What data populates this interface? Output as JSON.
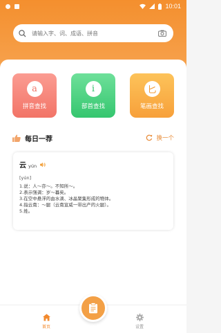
{
  "status_bar": {
    "time": "10:01"
  },
  "search": {
    "placeholder": "请输入字、词、成语、拼音"
  },
  "cards": [
    {
      "glyph": "a",
      "label": "拼音查找"
    },
    {
      "glyph": "i",
      "label": "部首查找"
    },
    {
      "glyph": "匕",
      "label": "笔画查找"
    }
  ],
  "daily": {
    "title": "每日一荐",
    "refresh_label": "换一个"
  },
  "word": {
    "char": "云",
    "pinyin": "yún",
    "bracket_pinyin": "[yún]",
    "definitions": [
      "1.说：人～亦～。不知所～。",
      "2.表示强调：岁～暮矣。",
      "3.在空中悬浮的由水滴、冰晶聚集形成的物体。",
      "4.指云南：～腿（云南宣威一带出产的火腿）。",
      "5.姓。"
    ]
  },
  "nav": {
    "home_label": "首页",
    "settings_label": "设置"
  },
  "colors": {
    "accent": "#f28a2e",
    "red_card": "#f27467",
    "green_card": "#35c66f",
    "orange_card": "#f7a03a"
  }
}
